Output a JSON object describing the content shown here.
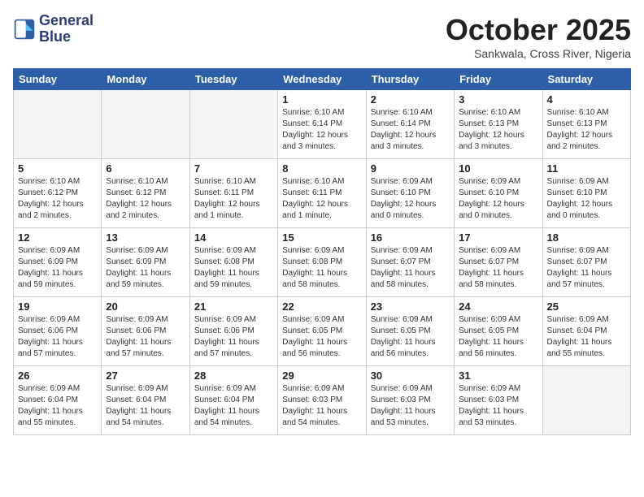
{
  "logo": {
    "line1": "General",
    "line2": "Blue"
  },
  "title": "October 2025",
  "location": "Sankwala, Cross River, Nigeria",
  "weekdays": [
    "Sunday",
    "Monday",
    "Tuesday",
    "Wednesday",
    "Thursday",
    "Friday",
    "Saturday"
  ],
  "weeks": [
    [
      {
        "day": "",
        "info": ""
      },
      {
        "day": "",
        "info": ""
      },
      {
        "day": "",
        "info": ""
      },
      {
        "day": "1",
        "info": "Sunrise: 6:10 AM\nSunset: 6:14 PM\nDaylight: 12 hours and 3 minutes."
      },
      {
        "day": "2",
        "info": "Sunrise: 6:10 AM\nSunset: 6:14 PM\nDaylight: 12 hours and 3 minutes."
      },
      {
        "day": "3",
        "info": "Sunrise: 6:10 AM\nSunset: 6:13 PM\nDaylight: 12 hours and 3 minutes."
      },
      {
        "day": "4",
        "info": "Sunrise: 6:10 AM\nSunset: 6:13 PM\nDaylight: 12 hours and 2 minutes."
      }
    ],
    [
      {
        "day": "5",
        "info": "Sunrise: 6:10 AM\nSunset: 6:12 PM\nDaylight: 12 hours and 2 minutes."
      },
      {
        "day": "6",
        "info": "Sunrise: 6:10 AM\nSunset: 6:12 PM\nDaylight: 12 hours and 2 minutes."
      },
      {
        "day": "7",
        "info": "Sunrise: 6:10 AM\nSunset: 6:11 PM\nDaylight: 12 hours and 1 minute."
      },
      {
        "day": "8",
        "info": "Sunrise: 6:10 AM\nSunset: 6:11 PM\nDaylight: 12 hours and 1 minute."
      },
      {
        "day": "9",
        "info": "Sunrise: 6:09 AM\nSunset: 6:10 PM\nDaylight: 12 hours and 0 minutes."
      },
      {
        "day": "10",
        "info": "Sunrise: 6:09 AM\nSunset: 6:10 PM\nDaylight: 12 hours and 0 minutes."
      },
      {
        "day": "11",
        "info": "Sunrise: 6:09 AM\nSunset: 6:10 PM\nDaylight: 12 hours and 0 minutes."
      }
    ],
    [
      {
        "day": "12",
        "info": "Sunrise: 6:09 AM\nSunset: 6:09 PM\nDaylight: 11 hours and 59 minutes."
      },
      {
        "day": "13",
        "info": "Sunrise: 6:09 AM\nSunset: 6:09 PM\nDaylight: 11 hours and 59 minutes."
      },
      {
        "day": "14",
        "info": "Sunrise: 6:09 AM\nSunset: 6:08 PM\nDaylight: 11 hours and 59 minutes."
      },
      {
        "day": "15",
        "info": "Sunrise: 6:09 AM\nSunset: 6:08 PM\nDaylight: 11 hours and 58 minutes."
      },
      {
        "day": "16",
        "info": "Sunrise: 6:09 AM\nSunset: 6:07 PM\nDaylight: 11 hours and 58 minutes."
      },
      {
        "day": "17",
        "info": "Sunrise: 6:09 AM\nSunset: 6:07 PM\nDaylight: 11 hours and 58 minutes."
      },
      {
        "day": "18",
        "info": "Sunrise: 6:09 AM\nSunset: 6:07 PM\nDaylight: 11 hours and 57 minutes."
      }
    ],
    [
      {
        "day": "19",
        "info": "Sunrise: 6:09 AM\nSunset: 6:06 PM\nDaylight: 11 hours and 57 minutes."
      },
      {
        "day": "20",
        "info": "Sunrise: 6:09 AM\nSunset: 6:06 PM\nDaylight: 11 hours and 57 minutes."
      },
      {
        "day": "21",
        "info": "Sunrise: 6:09 AM\nSunset: 6:06 PM\nDaylight: 11 hours and 57 minutes."
      },
      {
        "day": "22",
        "info": "Sunrise: 6:09 AM\nSunset: 6:05 PM\nDaylight: 11 hours and 56 minutes."
      },
      {
        "day": "23",
        "info": "Sunrise: 6:09 AM\nSunset: 6:05 PM\nDaylight: 11 hours and 56 minutes."
      },
      {
        "day": "24",
        "info": "Sunrise: 6:09 AM\nSunset: 6:05 PM\nDaylight: 11 hours and 56 minutes."
      },
      {
        "day": "25",
        "info": "Sunrise: 6:09 AM\nSunset: 6:04 PM\nDaylight: 11 hours and 55 minutes."
      }
    ],
    [
      {
        "day": "26",
        "info": "Sunrise: 6:09 AM\nSunset: 6:04 PM\nDaylight: 11 hours and 55 minutes."
      },
      {
        "day": "27",
        "info": "Sunrise: 6:09 AM\nSunset: 6:04 PM\nDaylight: 11 hours and 54 minutes."
      },
      {
        "day": "28",
        "info": "Sunrise: 6:09 AM\nSunset: 6:04 PM\nDaylight: 11 hours and 54 minutes."
      },
      {
        "day": "29",
        "info": "Sunrise: 6:09 AM\nSunset: 6:03 PM\nDaylight: 11 hours and 54 minutes."
      },
      {
        "day": "30",
        "info": "Sunrise: 6:09 AM\nSunset: 6:03 PM\nDaylight: 11 hours and 53 minutes."
      },
      {
        "day": "31",
        "info": "Sunrise: 6:09 AM\nSunset: 6:03 PM\nDaylight: 11 hours and 53 minutes."
      },
      {
        "day": "",
        "info": ""
      }
    ]
  ]
}
